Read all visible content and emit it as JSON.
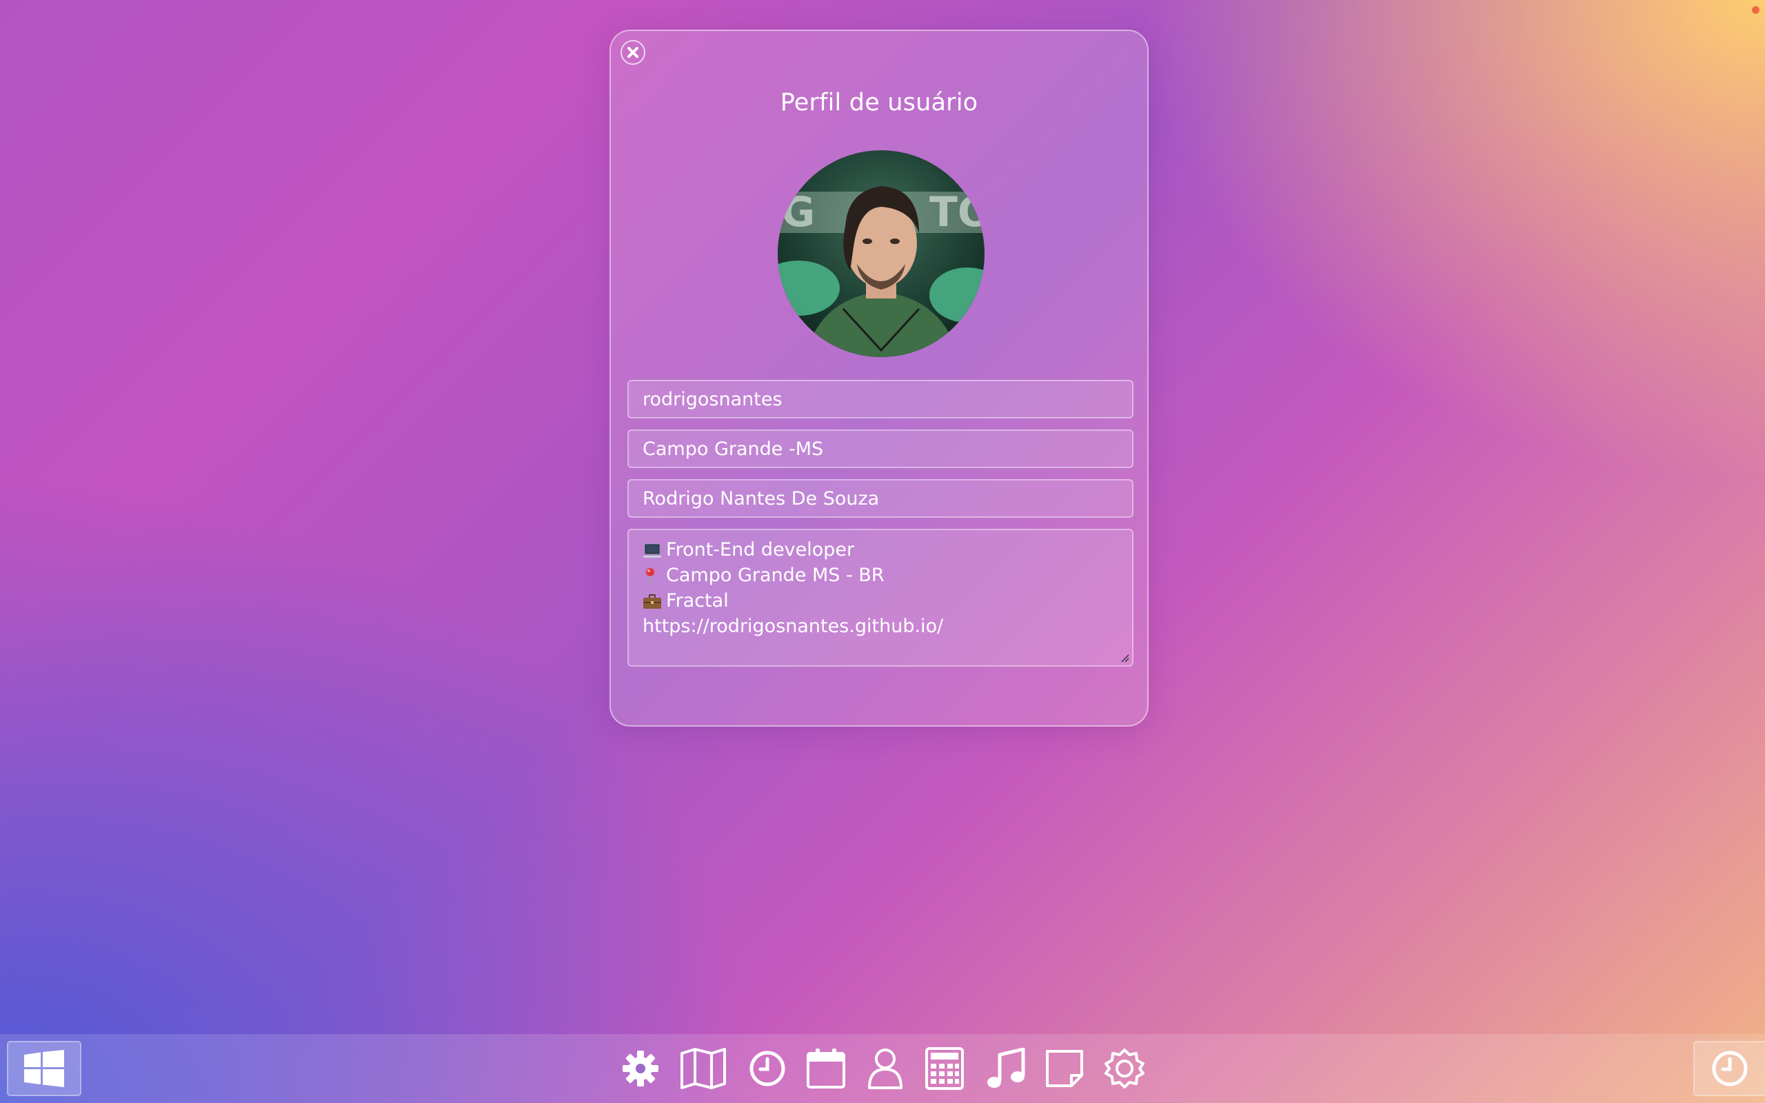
{
  "window": {
    "title": "Perfil de usuário"
  },
  "profile": {
    "avatar_alt": "avatar",
    "username": "rodrigosnantes",
    "location": "Campo Grande -MS",
    "full_name": "Rodrigo Nantes De Souza",
    "bio": [
      {
        "icon": "laptop-icon",
        "text": "Front-End developer"
      },
      {
        "icon": "pin-icon",
        "text": "Campo Grande MS - BR"
      },
      {
        "icon": "briefcase-icon",
        "text": "Fractal"
      },
      {
        "icon": "",
        "text": "https://rodrigosnantes.github.io/"
      }
    ]
  },
  "taskbar": {
    "start_icon": "windows-icon",
    "dock_items": [
      "gear-icon",
      "map-icon",
      "clock-icon",
      "calendar-icon",
      "user-icon",
      "calculator-icon",
      "music-icon",
      "note-icon",
      "brightness-icon"
    ],
    "tray_icon": "clock-icon"
  },
  "colors": {
    "accent_dot": "#f0673f",
    "text": "#ffffff"
  }
}
